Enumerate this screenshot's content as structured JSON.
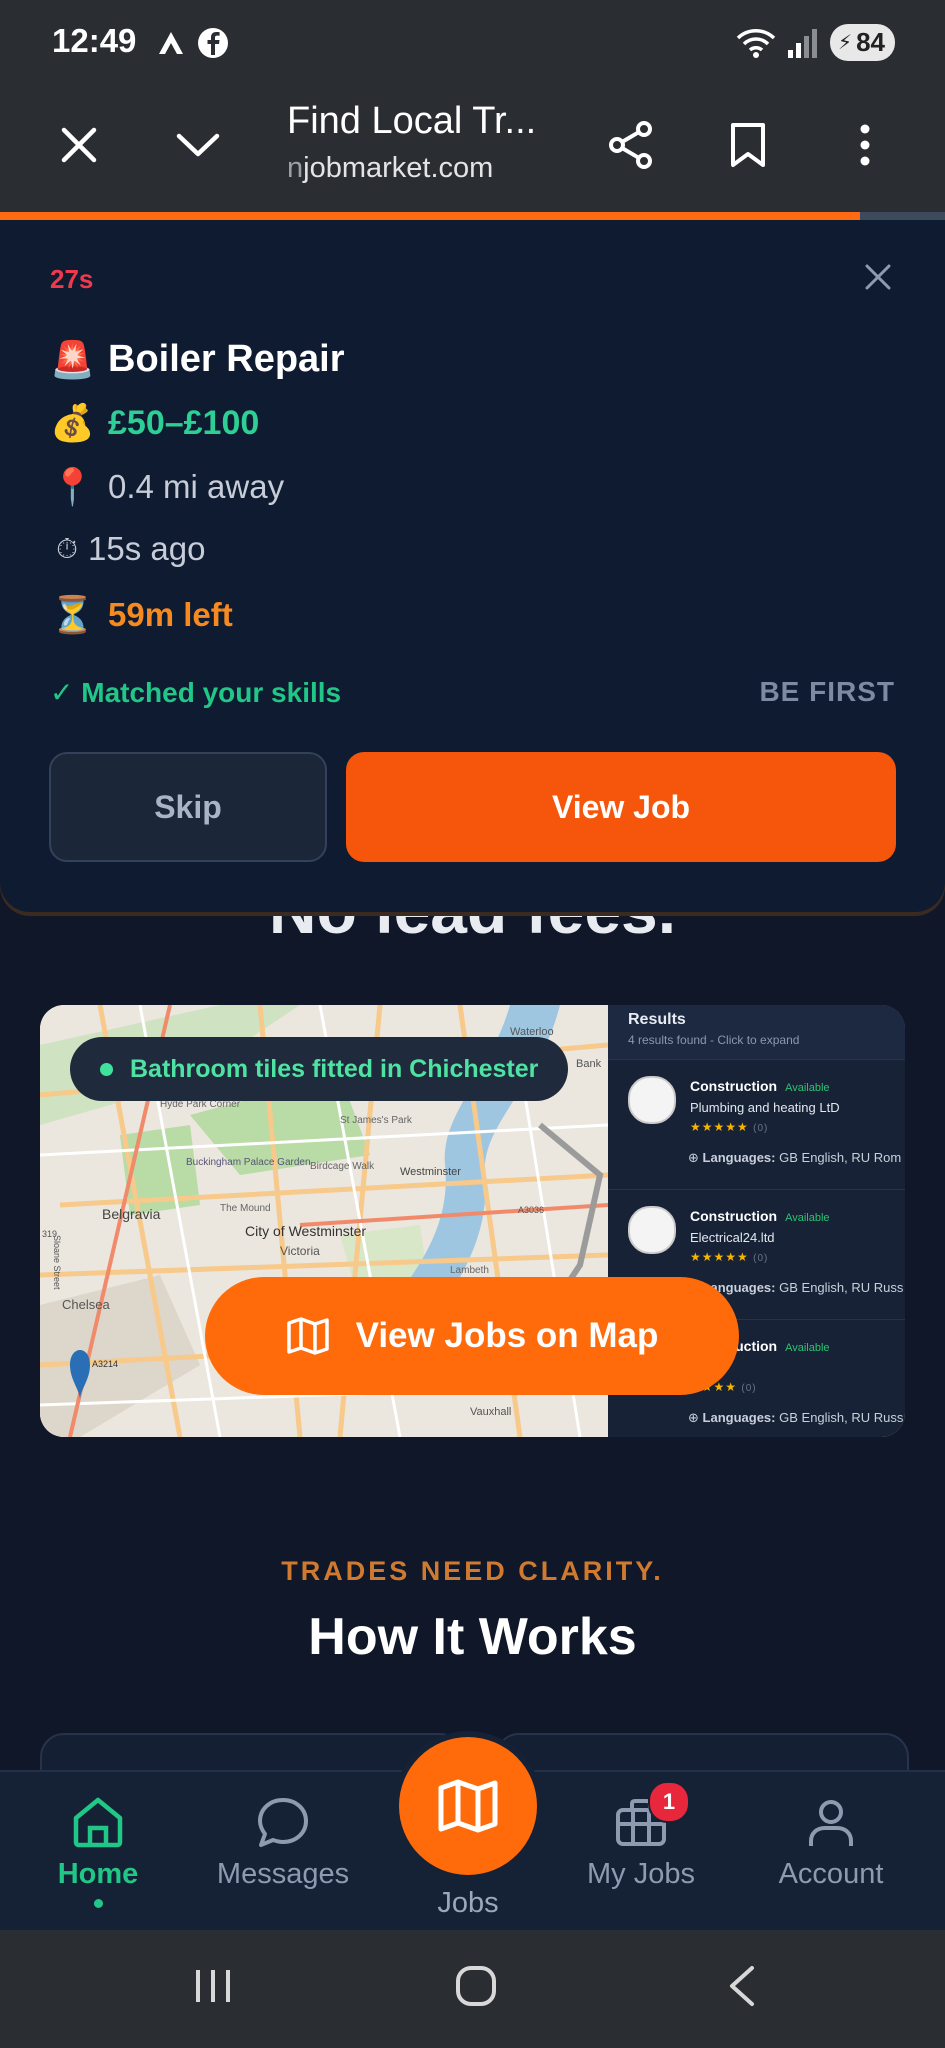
{
  "status_bar": {
    "time": "12:49",
    "battery": "84"
  },
  "browser": {
    "title": "Find Local Tr...",
    "url_prefix": "n",
    "url": "jobmarket.com"
  },
  "alert": {
    "timer": "27s",
    "emoji_title": "🚨",
    "title": "Boiler Repair",
    "emoji_price": "💰",
    "price": "£50–£100",
    "emoji_distance": "📍",
    "distance": "0.4 mi away",
    "emoji_posted": "⏱",
    "posted": "15s ago",
    "emoji_left": "⏳",
    "time_left": "59m left",
    "matched": "✓ Matched your skills",
    "be_first": "BE FIRST",
    "skip_label": "Skip",
    "view_label": "View Job"
  },
  "hero": {
    "heading": "No lead fees."
  },
  "map": {
    "pill_text": "Bathroom tiles fitted in Chichester",
    "cta_label": "View Jobs on Map",
    "place_labels": [
      "Waterloo",
      "Bank",
      "Hyde Park Corner",
      "St James's Park",
      "Birdcage Walk",
      "Buckingham Palace Garden",
      "Westminster",
      "Belgravia",
      "The Mound",
      "City of Westminster",
      "Victoria",
      "Lambeth",
      "A3036",
      "Chelsea",
      "A3214",
      "Vauxhall",
      "Sloane Street",
      "319"
    ],
    "results": {
      "title": "Results",
      "subtitle": "4 results found - Click to expand",
      "items": [
        {
          "category": "Construction",
          "status": "Available",
          "company": "Plumbing and heating LtD",
          "stars": "★★★★★",
          "reviews": "(0)",
          "languages_label": "Languages:",
          "languages": "GB English, RU Rom"
        },
        {
          "category": "Construction",
          "status": "Available",
          "company": "Electrical24.ltd",
          "stars": "★★★★★",
          "reviews": "(0)",
          "languages_label": "Languages:",
          "languages": "GB English, RU Russ"
        },
        {
          "category": "Construction",
          "status": "Available",
          "company": "",
          "stars": "★★★★",
          "reviews": "(0)",
          "languages_label": "Languages:",
          "languages": "GB English, RU Russ"
        }
      ]
    }
  },
  "section": {
    "tagline": "TRADES NEED CLARITY.",
    "title": "How It Works"
  },
  "nav": {
    "home": "Home",
    "messages": "Messages",
    "jobs": "Jobs",
    "my_jobs": "My Jobs",
    "my_jobs_badge": "1",
    "account": "Account"
  },
  "colors": {
    "accent": "#ff6a0a",
    "success": "#21c787",
    "background": "#0f1728"
  },
  "progress": 0.91
}
